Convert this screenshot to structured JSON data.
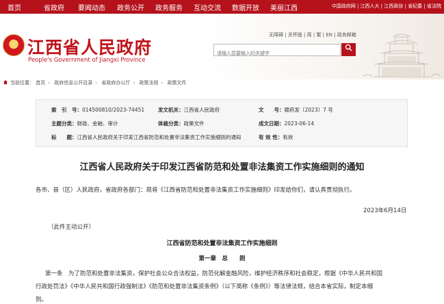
{
  "topnav": {
    "items": [
      "首页",
      "省政府",
      "要闻动态",
      "政务公开",
      "政务服务",
      "互动交流",
      "数据开放",
      "美丽江西"
    ],
    "links": [
      "中国政府网",
      "江西人大",
      "江西政协",
      "省纪委",
      "省法院"
    ]
  },
  "header": {
    "title": "江西省人民政府",
    "subtitle": "People's Government of Jiangxi Province",
    "util_links": [
      "无障碍",
      "关怀版",
      "简",
      "繁",
      "EN",
      "政务邮箱"
    ],
    "search_placeholder": "请输入您要输入的关键字",
    "search_icon": "search-icon"
  },
  "breadcrumb": [
    "首页",
    "政府信息公开目录",
    "省政府办公厅",
    "政策法规",
    "政策文件"
  ],
  "meta": {
    "index_label": "索　引　号：",
    "index_value": "014500810/2023-74451",
    "issuer_label": "发文机关：",
    "issuer_value": "江西省人民政府",
    "docno_label": "文　　号：",
    "docno_value": "赣府发〔2023〕7 号",
    "topic_label": "主题分类：",
    "topic_value": "财政、金融、审计",
    "genre_label": "体裁分类：",
    "genre_value": "政策文件",
    "date_label": "成文日期：",
    "date_value": "2023-06-14",
    "subject_label": "标　　题：",
    "subject_value": "江西省人民政府关于印发江西省防范和处置非法集资工作实施细则的通知",
    "validity_label": "有 效 性：",
    "validity_value": "有效"
  },
  "content": {
    "title": "江西省人民政府关于印发江西省防范和处置非法集资工作实施细则的通知",
    "salutation": "各市、县（区）人民政府，省政府各部门：现将《江西省防范和处置非法集资工作实施细则》印发给你们，请认真贯彻执行。",
    "date": "2023年6月14日",
    "public_note": "（此件主动公开）",
    "rule_title": "江西省防范和处置非法集资工作实施细则",
    "chapter": "第一章　总　　则",
    "article1_line1": "第一条　为了防范和处置非法集资，保护社会公众合法权益，防范化解金融风险，维护经济秩序和社会稳定，根据《中华人民共和国",
    "article1_line2": "行政处罚法》《中华人民共和国行政强制法》《防范和处置非法集资条例》（以下简称《条例》）等法律法规，结合本省实际，制定本细",
    "article1_line3": "则。"
  }
}
